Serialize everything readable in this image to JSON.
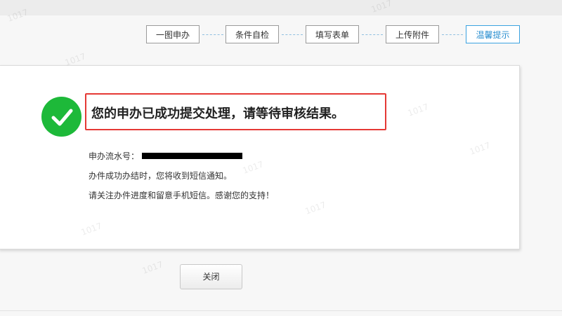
{
  "steps": [
    {
      "label": "一图申办",
      "active": false
    },
    {
      "label": "条件自检",
      "active": false
    },
    {
      "label": "填写表单",
      "active": false
    },
    {
      "label": "上传附件",
      "active": false
    },
    {
      "label": "温馨提示",
      "active": true
    }
  ],
  "result": {
    "headline": "您的申办已成功提交处理，请等待审核结果。",
    "serial_label": "申办流水号：",
    "line2": "办件成功办结时，您将收到短信通知。",
    "line3": "请关注办件进度和留意手机短信。感谢您的支持！"
  },
  "close_button": "关闭",
  "watermark": {
    "number": "1017"
  },
  "colors": {
    "success": "#1db939",
    "highlight": "#e53935",
    "active_step": "#3ba3e0"
  }
}
